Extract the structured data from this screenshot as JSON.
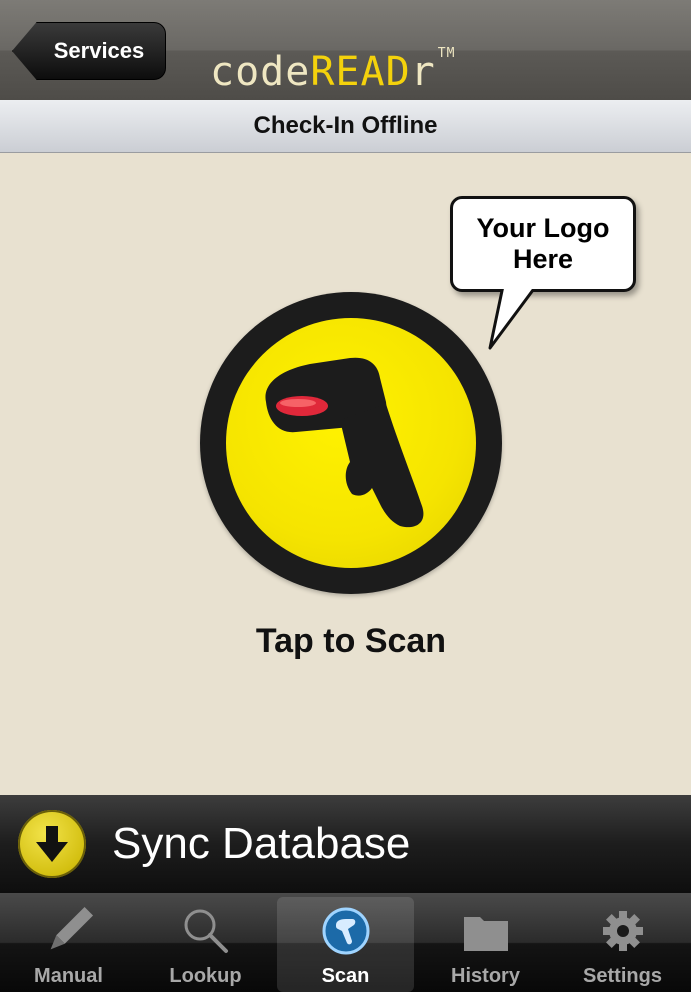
{
  "navbar": {
    "back_label": "Services",
    "brand": {
      "part1": "code",
      "part2": "READ",
      "part3": "r",
      "tm": "TM"
    }
  },
  "subheader": {
    "title": "Check-In Offline"
  },
  "logo_bubble": {
    "text_line1": "Your Logo",
    "text_line2": "Here"
  },
  "scan": {
    "label": "Tap to Scan"
  },
  "sync": {
    "label": "Sync Database"
  },
  "tabs": [
    {
      "label": "Manual",
      "icon": "pencil-icon",
      "active": false
    },
    {
      "label": "Lookup",
      "icon": "magnifier-icon",
      "active": false
    },
    {
      "label": "Scan",
      "icon": "scanner-icon",
      "active": true
    },
    {
      "label": "History",
      "icon": "folder-icon",
      "active": false
    },
    {
      "label": "Settings",
      "icon": "gear-icon",
      "active": false
    }
  ],
  "colors": {
    "background": "#e8e1d0",
    "brand_accent": "#f4d20c",
    "scan_yellow": "#f5e400",
    "scan_ring": "#1c1c1c"
  }
}
